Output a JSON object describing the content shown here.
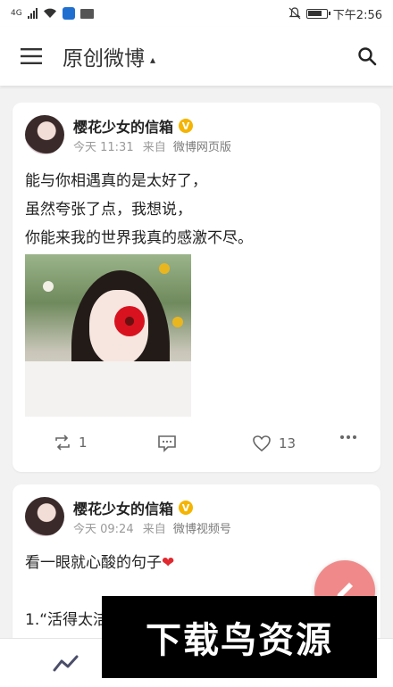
{
  "status_bar": {
    "signal": "4G",
    "time": "下午2:56",
    "icons": [
      "signal-icon",
      "wifi-icon",
      "app-notification-icon",
      "mail-icon",
      "mute-bell-icon",
      "battery-icon"
    ]
  },
  "app_bar": {
    "title": "原创微博",
    "menu_icon": "hamburger-menu-icon",
    "search_icon": "search-icon",
    "caret": "▴"
  },
  "posts": [
    {
      "user": "樱花少女的信箱",
      "verified": true,
      "time": "今天 11:31",
      "source_prefix": "来自",
      "source": "微博网页版",
      "lines": [
        "能与你相遇真的是太好了，",
        "虽然夸张了点，我想说，",
        "你能来我的世界我真的感激不尽。"
      ],
      "image_icon": "girl-with-flower-photo",
      "reposts": "1",
      "comments": "",
      "likes": "13"
    },
    {
      "user": "樱花少女的信箱",
      "verified": true,
      "time": "今天 09:24",
      "source_prefix": "来自",
      "source": "微博视频号",
      "line1": "看一眼就心酸的句子",
      "heart": "❤",
      "line3": "1.“活得太洁"
    }
  ],
  "fab": {
    "icon": "edit-pencil-icon"
  },
  "bottom_nav": {
    "icon": "trend-chart-icon"
  },
  "watermark": {
    "text": "下载鸟资源"
  },
  "colors": {
    "accent": "#f08a8a",
    "verified_badge": "#f5b400",
    "heart": "#e0282e",
    "background": "#f2f2f2"
  }
}
